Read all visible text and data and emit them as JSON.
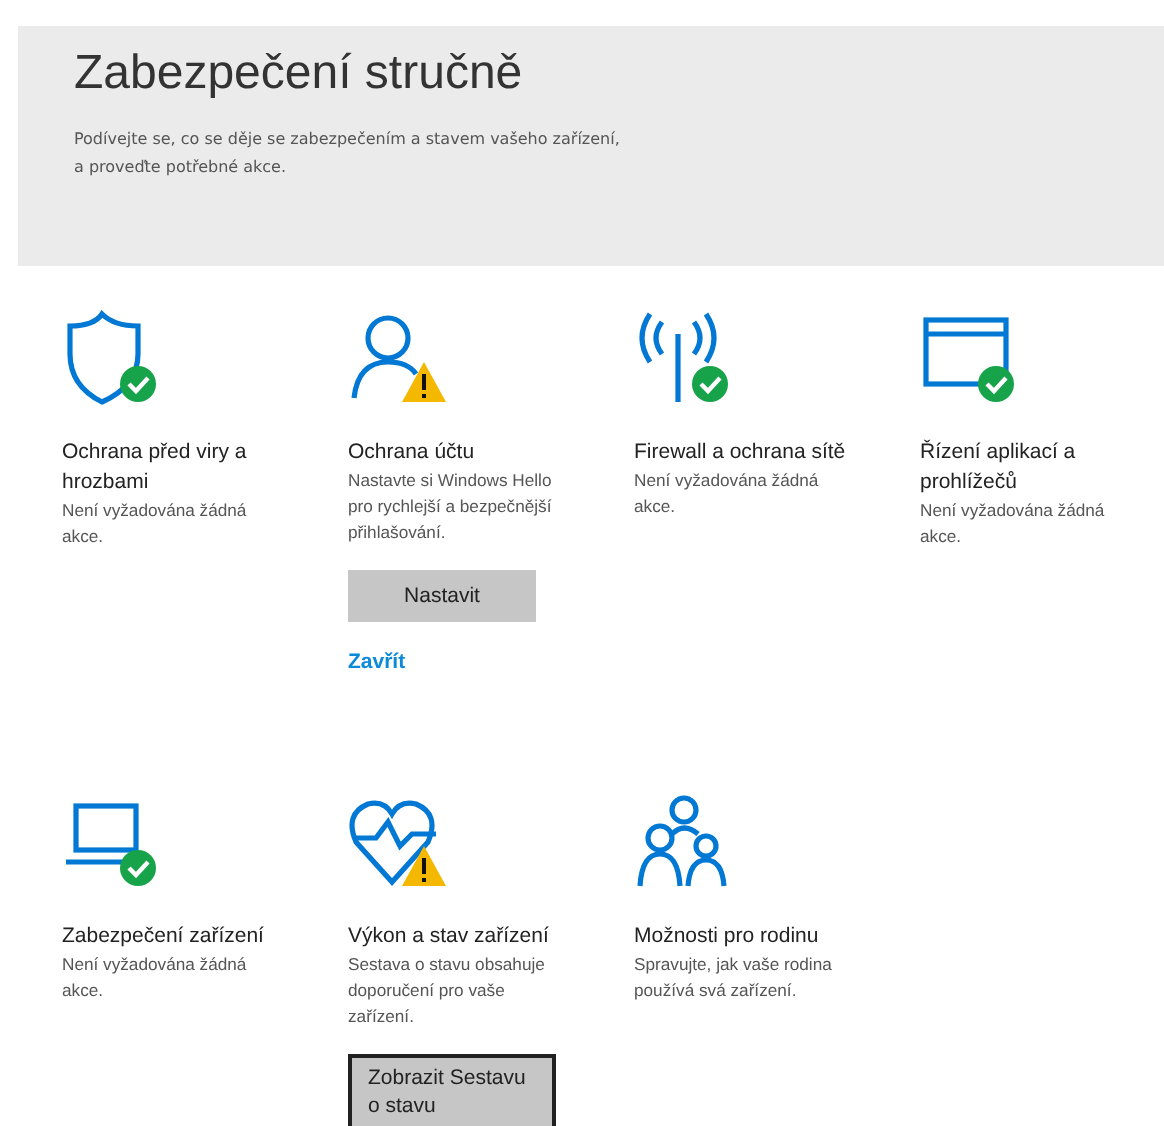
{
  "header": {
    "title": "Zabezpečení stručně",
    "subtitle": "Podívejte se, co se děje se zabezpečením a stavem vašeho zařízení,\na proveďte potřebné akce."
  },
  "tiles": [
    {
      "title": "Ochrana před viry a hrozbami",
      "description": "Není vyžadována žádná akce."
    },
    {
      "title": "Ochrana účtu",
      "description": "Nastavte si Windows Hello pro rychlejší a bezpečnější přihlašování.",
      "button": {
        "label": "Nastavit",
        "focused": false
      },
      "link": "Zavřít"
    },
    {
      "title": "Firewall a ochrana sítě",
      "description": "Není vyžadována žádná akce."
    },
    {
      "title": "Řízení aplikací a prohlížečů",
      "description": "Není vyžadována žádná akce."
    },
    {
      "title": "Zabezpečení zařízení",
      "description": "Není vyžadována žádná akce."
    },
    {
      "title": "Výkon a stav zařízení",
      "description": "Sestava o stavu obsahuje doporučení pro vaše zařízení.",
      "button": {
        "label": "Zobrazit Sestavu o stavu",
        "focused": true
      }
    },
    {
      "title": "Možnosti pro rodinu",
      "description": "Spravujte, jak vaše rodina používá svá zařízení."
    }
  ]
}
